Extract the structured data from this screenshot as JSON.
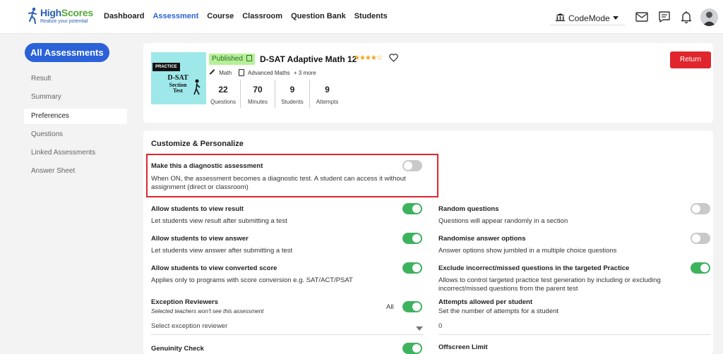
{
  "logo": {
    "name_high": "High",
    "name_scores": "Scores",
    "tagline": "Realize your potential"
  },
  "nav": [
    {
      "label": "Dashboard",
      "active": false
    },
    {
      "label": "Assessment",
      "active": true
    },
    {
      "label": "Course",
      "active": false
    },
    {
      "label": "Classroom",
      "active": false
    },
    {
      "label": "Question Bank",
      "active": false
    },
    {
      "label": "Students",
      "active": false
    }
  ],
  "mode": {
    "label": "CodeMode"
  },
  "topicons": [
    "mail-icon",
    "chat-icon",
    "bell-icon"
  ],
  "sidebar": {
    "main_button": "All Assessments",
    "items": [
      {
        "label": "Result",
        "selected": false
      },
      {
        "label": "Summary",
        "selected": false
      },
      {
        "label": "Preferences",
        "selected": true
      },
      {
        "label": "Questions",
        "selected": false
      },
      {
        "label": "Linked Assessments",
        "selected": false
      },
      {
        "label": "Answer Sheet",
        "selected": false
      }
    ]
  },
  "assessment": {
    "thumb_tag": "PRACTICE",
    "thumb_line1": "D-SAT",
    "thumb_line2": "Section",
    "thumb_line3": "Test",
    "status": "Published",
    "title": "D-SAT Adaptive Math 12",
    "rating": "★★★★☆",
    "subject": "Math",
    "topic": "Advanced Maths",
    "more": "+ 3 more",
    "stats": [
      {
        "value": "22",
        "label": "Questions"
      },
      {
        "value": "70",
        "label": "Minutes"
      },
      {
        "value": "9",
        "label": "Students"
      },
      {
        "value": "9",
        "label": "Attempts"
      }
    ],
    "return_label": "Return"
  },
  "settings": {
    "heading": "Customize & Personalize",
    "diagnostic": {
      "title": "Make this a diagnostic assessment",
      "desc": "When ON, the assessment becomes a diagnostic test. A student can access it without assignment (direct or classroom)",
      "on": false
    },
    "left": [
      {
        "title": "Allow students to view result",
        "desc": "Let students view result after submitting a test",
        "on": true
      },
      {
        "title": "Allow students to view answer",
        "desc": "Let students view answer after submitting a test",
        "on": true
      },
      {
        "title": "Allow students to view converted score",
        "desc": "Applies only to programs with score conversion e.g. SAT/ACT/PSAT",
        "on": true
      }
    ],
    "right": [
      {
        "title": "Random questions",
        "desc": "Questions will appear randomly in a section",
        "on": false
      },
      {
        "title": "Randomise answer options",
        "desc": "Answer options show jumbled in a multiple choice questions",
        "on": false
      },
      {
        "title": "Exclude incorrect/missed questions in the targeted Practice",
        "desc": "Allows to control targeted practice test generation by including or excluding incorrect/missed questions from the parent test",
        "on": true
      }
    ],
    "reviewers": {
      "title": "Exception Reviewers",
      "note": "Selected teachers won't see this assessment",
      "all_label": "All",
      "on": true,
      "select_placeholder": "Select exception reviewer"
    },
    "attempts": {
      "title": "Attempts allowed per student",
      "desc": "Set the number of attempts for a student",
      "value": "0"
    },
    "genuinity": {
      "title": "Genuinity Check",
      "on": true
    },
    "offscreen": {
      "title": "Offscreen Limit"
    }
  }
}
